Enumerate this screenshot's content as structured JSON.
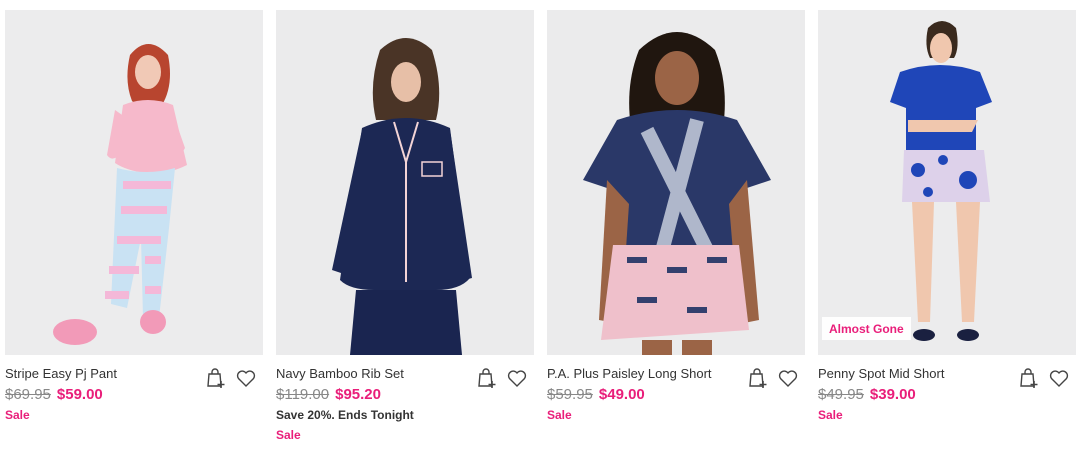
{
  "products": [
    {
      "name": "Stripe Easy Pj Pant",
      "was_price": "$69.95",
      "now_price": "$59.00",
      "promo": "",
      "sale_label": "Sale",
      "badge": "",
      "add_to_bag_icon": "bag-plus-icon",
      "wishlist_icon": "heart-outline-icon"
    },
    {
      "name": "Navy Bamboo Rib Set",
      "was_price": "$119.00",
      "now_price": "$95.20",
      "promo": "Save 20%. Ends Tonight",
      "sale_label": "Sale",
      "badge": "",
      "add_to_bag_icon": "bag-plus-icon",
      "wishlist_icon": "heart-outline-icon"
    },
    {
      "name": "P.A. Plus Paisley Long Short",
      "was_price": "$59.95",
      "now_price": "$49.00",
      "promo": "",
      "sale_label": "Sale",
      "badge": "",
      "add_to_bag_icon": "bag-plus-icon",
      "wishlist_icon": "heart-outline-icon"
    },
    {
      "name": "Penny Spot Mid Short",
      "was_price": "$49.95",
      "now_price": "$39.00",
      "promo": "",
      "sale_label": "Sale",
      "badge": "Almost Gone",
      "add_to_bag_icon": "bag-plus-icon",
      "wishlist_icon": "heart-outline-icon"
    }
  ],
  "colors": {
    "accent_pink": "#e91e7a",
    "text": "#333333",
    "strikethrough": "#888888",
    "photo_background": "#ededee"
  }
}
